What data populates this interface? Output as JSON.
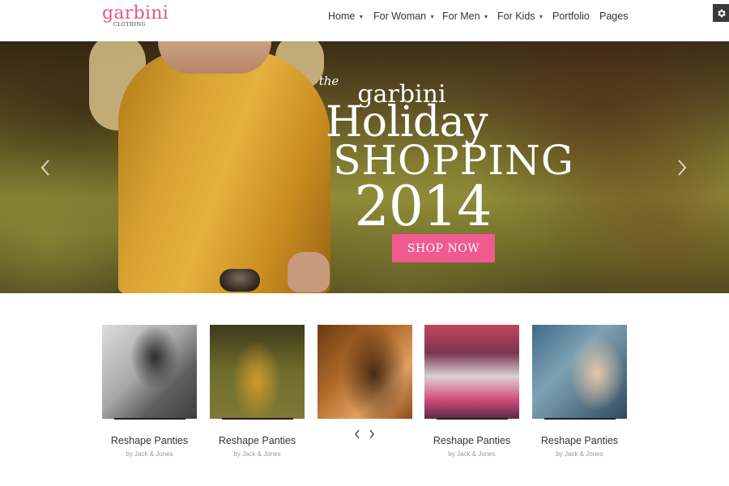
{
  "header": {
    "logo": {
      "name": "garbini",
      "subtitle": "CLOTHING"
    },
    "nav": [
      {
        "label": "Home",
        "has_dropdown": true
      },
      {
        "label": "For Woman",
        "has_dropdown": true
      },
      {
        "label": "For Men",
        "has_dropdown": true
      },
      {
        "label": "For Kids",
        "has_dropdown": true
      },
      {
        "label": "Portfolio",
        "has_dropdown": false
      },
      {
        "label": "Pages",
        "has_dropdown": false
      }
    ],
    "settings_icon": "gear-icon"
  },
  "hero": {
    "line1": "the",
    "line2": "garbini",
    "line3": "Holiday",
    "line4": "SHOPPING",
    "line5": "2014",
    "cta": "SHOP NOW",
    "prev_icon": "chevron-left-icon",
    "next_icon": "chevron-right-icon"
  },
  "products": [
    {
      "title": "Reshape Panties",
      "subtitle": "by Jack & Jones"
    },
    {
      "title": "Reshape Panties",
      "subtitle": "by Jack & Jones"
    },
    {
      "title": "",
      "subtitle": ""
    },
    {
      "title": "Reshape Panties",
      "subtitle": "by Jack & Jones"
    },
    {
      "title": "Reshape Panties",
      "subtitle": "by Jack & Jones"
    }
  ],
  "colors": {
    "brand_pink": "#e0578f",
    "button_pink": "#f05a8f",
    "settings_bg": "#3a3a3a"
  }
}
